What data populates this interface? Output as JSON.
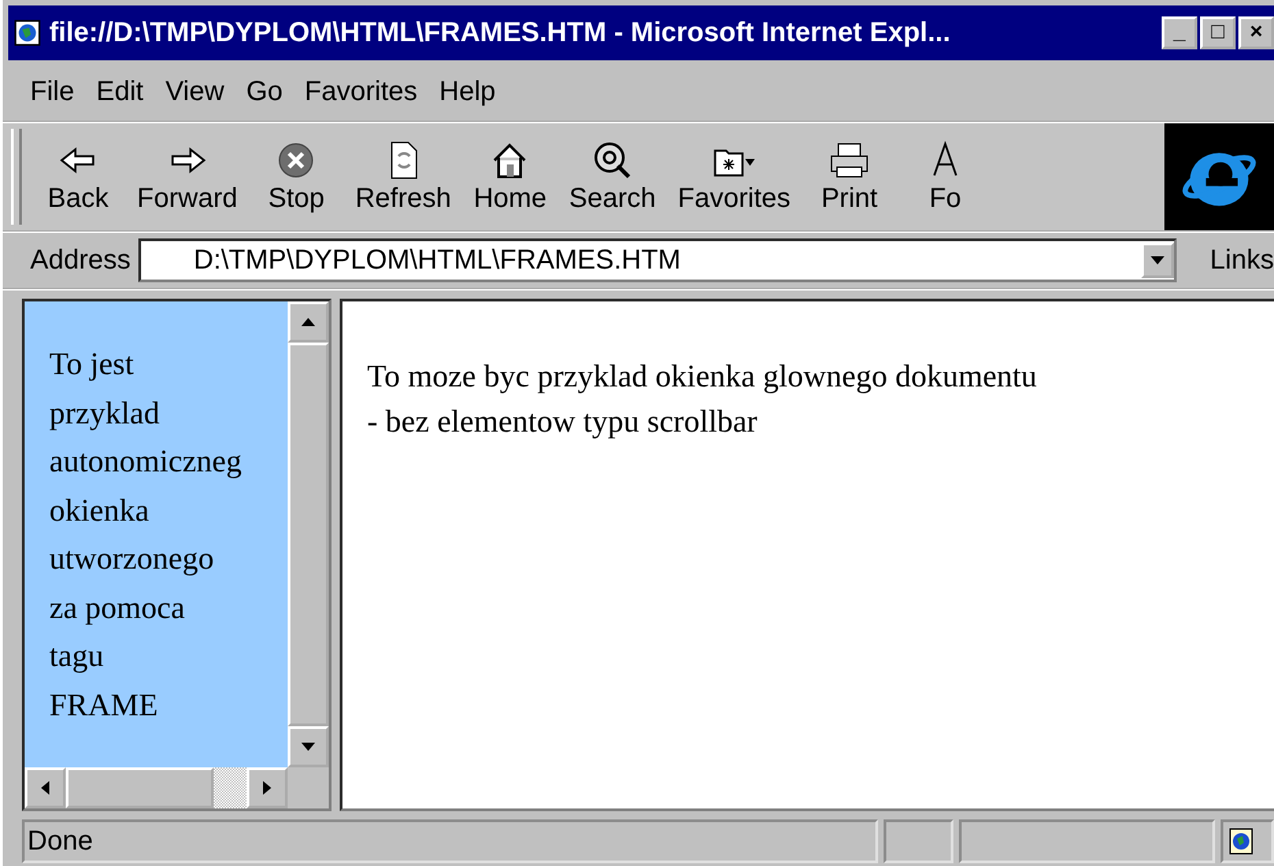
{
  "window": {
    "title": "file://D:\\TMP\\DYPLOM\\HTML\\FRAMES.HTM - Microsoft Internet Expl...",
    "controls": [
      "_",
      "□",
      "×"
    ]
  },
  "menu": [
    "File",
    "Edit",
    "View",
    "Go",
    "Favorites",
    "Help"
  ],
  "toolbar": [
    {
      "label": "Back"
    },
    {
      "label": "Forward"
    },
    {
      "label": "Stop"
    },
    {
      "label": "Refresh"
    },
    {
      "label": "Home"
    },
    {
      "label": "Search"
    },
    {
      "label": "Favorites"
    },
    {
      "label": "Print"
    },
    {
      "label": "Fo"
    }
  ],
  "address": {
    "label": "Address",
    "value": "D:\\TMP\\DYPLOM\\HTML\\FRAMES.HTM",
    "links": "Links"
  },
  "left_frame": {
    "lines": [
      "To jest",
      "przyklad",
      "autonomiczneg",
      "okienka",
      "utworzonego",
      "za pomoca",
      "tagu",
      "FRAME"
    ]
  },
  "main_frame": {
    "lines": [
      "To moze byc przyklad okienka glownego dokumentu",
      "- bez elementow typu scrollbar"
    ]
  },
  "status_bar": {
    "text": "Done"
  }
}
